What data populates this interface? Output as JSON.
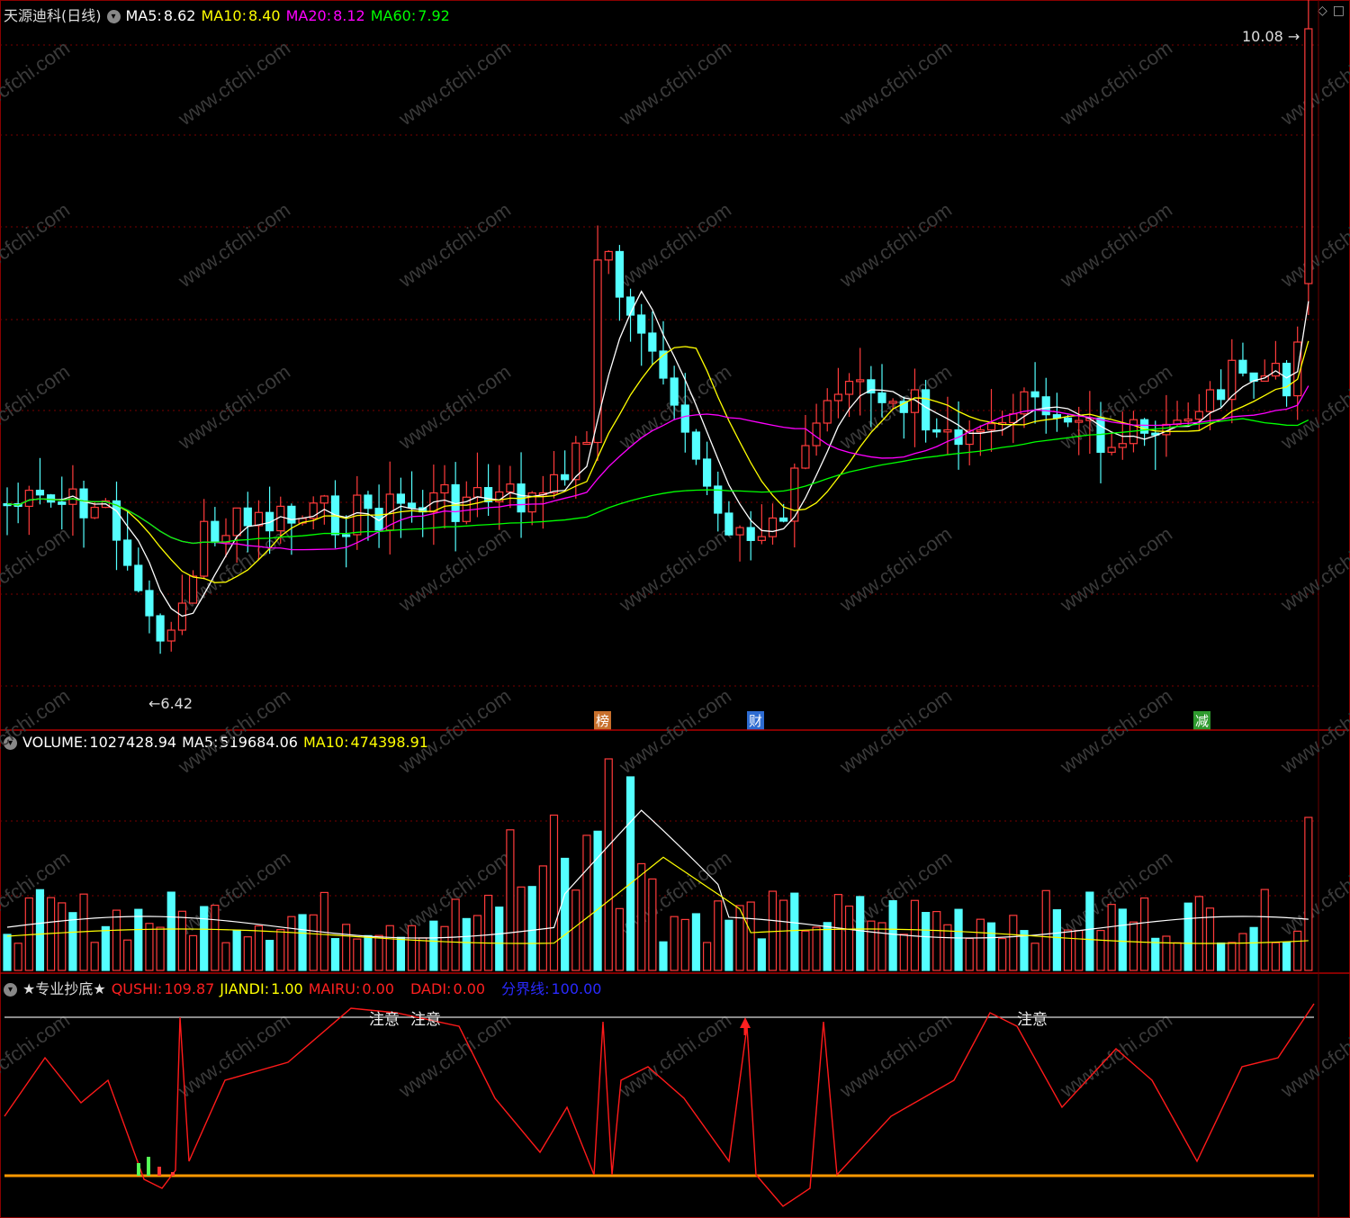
{
  "window": {
    "title": "天源迪科(日线)"
  },
  "price_panel": {
    "ma5": {
      "label": "MA5:",
      "value": "8.62",
      "color": "#ffffff"
    },
    "ma10": {
      "label": "MA10:",
      "value": "8.40",
      "color": "#ffff00"
    },
    "ma20": {
      "label": "MA20:",
      "value": "8.12",
      "color": "#ff00ff"
    },
    "ma60": {
      "label": "MA60:",
      "value": "7.92",
      "color": "#00ff00"
    },
    "high_label": "10.08",
    "low_label": "6.42",
    "markers": [
      {
        "text": "榜",
        "color": "#c8702c"
      },
      {
        "text": "财",
        "color": "#2d6bd1"
      },
      {
        "text": "减",
        "color": "#2e9a2e"
      }
    ]
  },
  "volume_panel": {
    "volume": {
      "label": "VOLUME:",
      "value": "1027428.94"
    },
    "ma5": {
      "label": "MA5:",
      "value": "519684.06"
    },
    "ma10": {
      "label": "MA10:",
      "value": "474398.91"
    }
  },
  "indicator_panel": {
    "name": "★专业抄底★",
    "qushi": {
      "label": "QUSHI:",
      "value": "109.87",
      "color": "#ff2020"
    },
    "jiandi": {
      "label": "JIANDI:",
      "value": "1.00",
      "color": "#ffff00"
    },
    "mairu": {
      "label": "MAIRU:",
      "value": "0.00",
      "color": "#ff2020"
    },
    "dadi": {
      "label": "DADI:",
      "value": "0.00",
      "color": "#ff2020"
    },
    "fenjie": {
      "label": "分界线:",
      "value": "100.00",
      "color": "#2020ff"
    },
    "notes": [
      "注意",
      "注意",
      "注意"
    ]
  },
  "watermark": "www.cfchi.com",
  "colors": {
    "up": "#ff3b3b",
    "down": "#54ffff",
    "grid": "#7a0000"
  }
}
